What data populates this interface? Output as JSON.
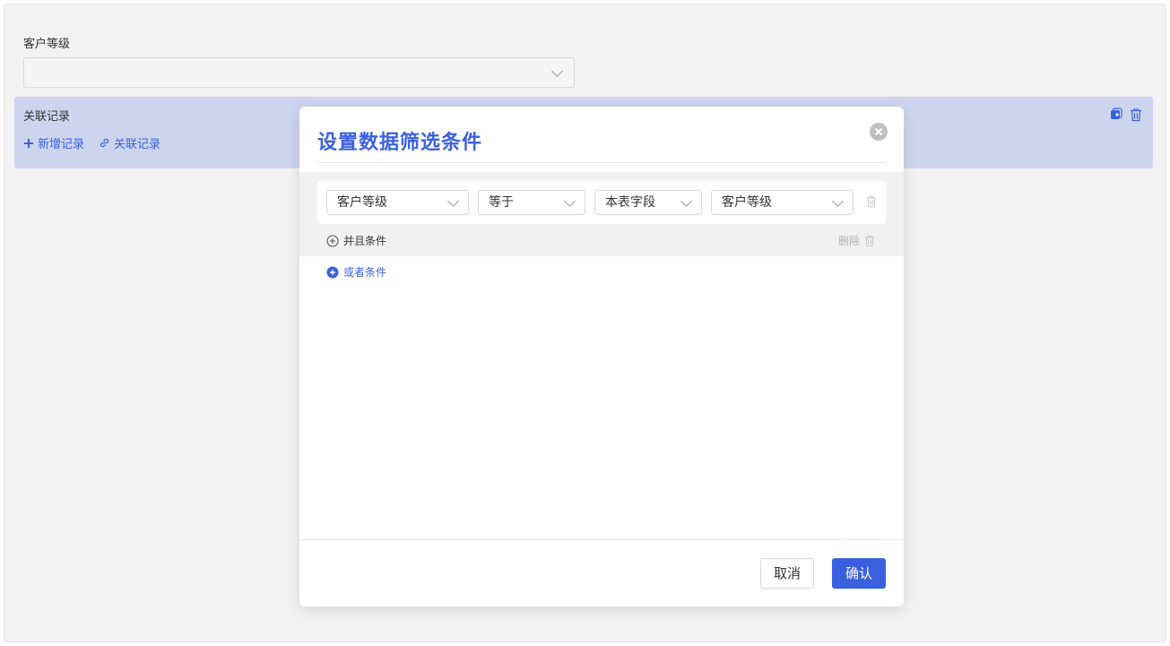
{
  "form": {
    "customer_level_label": "客户等级",
    "customer_level_value": ""
  },
  "related": {
    "title": "关联记录",
    "add_label": "新增记录",
    "link_label": "关联记录"
  },
  "modal": {
    "title": "设置数据筛选条件",
    "condition": {
      "field": "客户等级",
      "operator": "等于",
      "value_type": "本表字段",
      "value": "客户等级"
    },
    "and_label": "并且条件",
    "delete_label": "删除",
    "or_label": "或者条件",
    "cancel_label": "取消",
    "confirm_label": "确认"
  },
  "colors": {
    "accent": "#3a60e0",
    "related_bg": "#cdd5ee"
  }
}
